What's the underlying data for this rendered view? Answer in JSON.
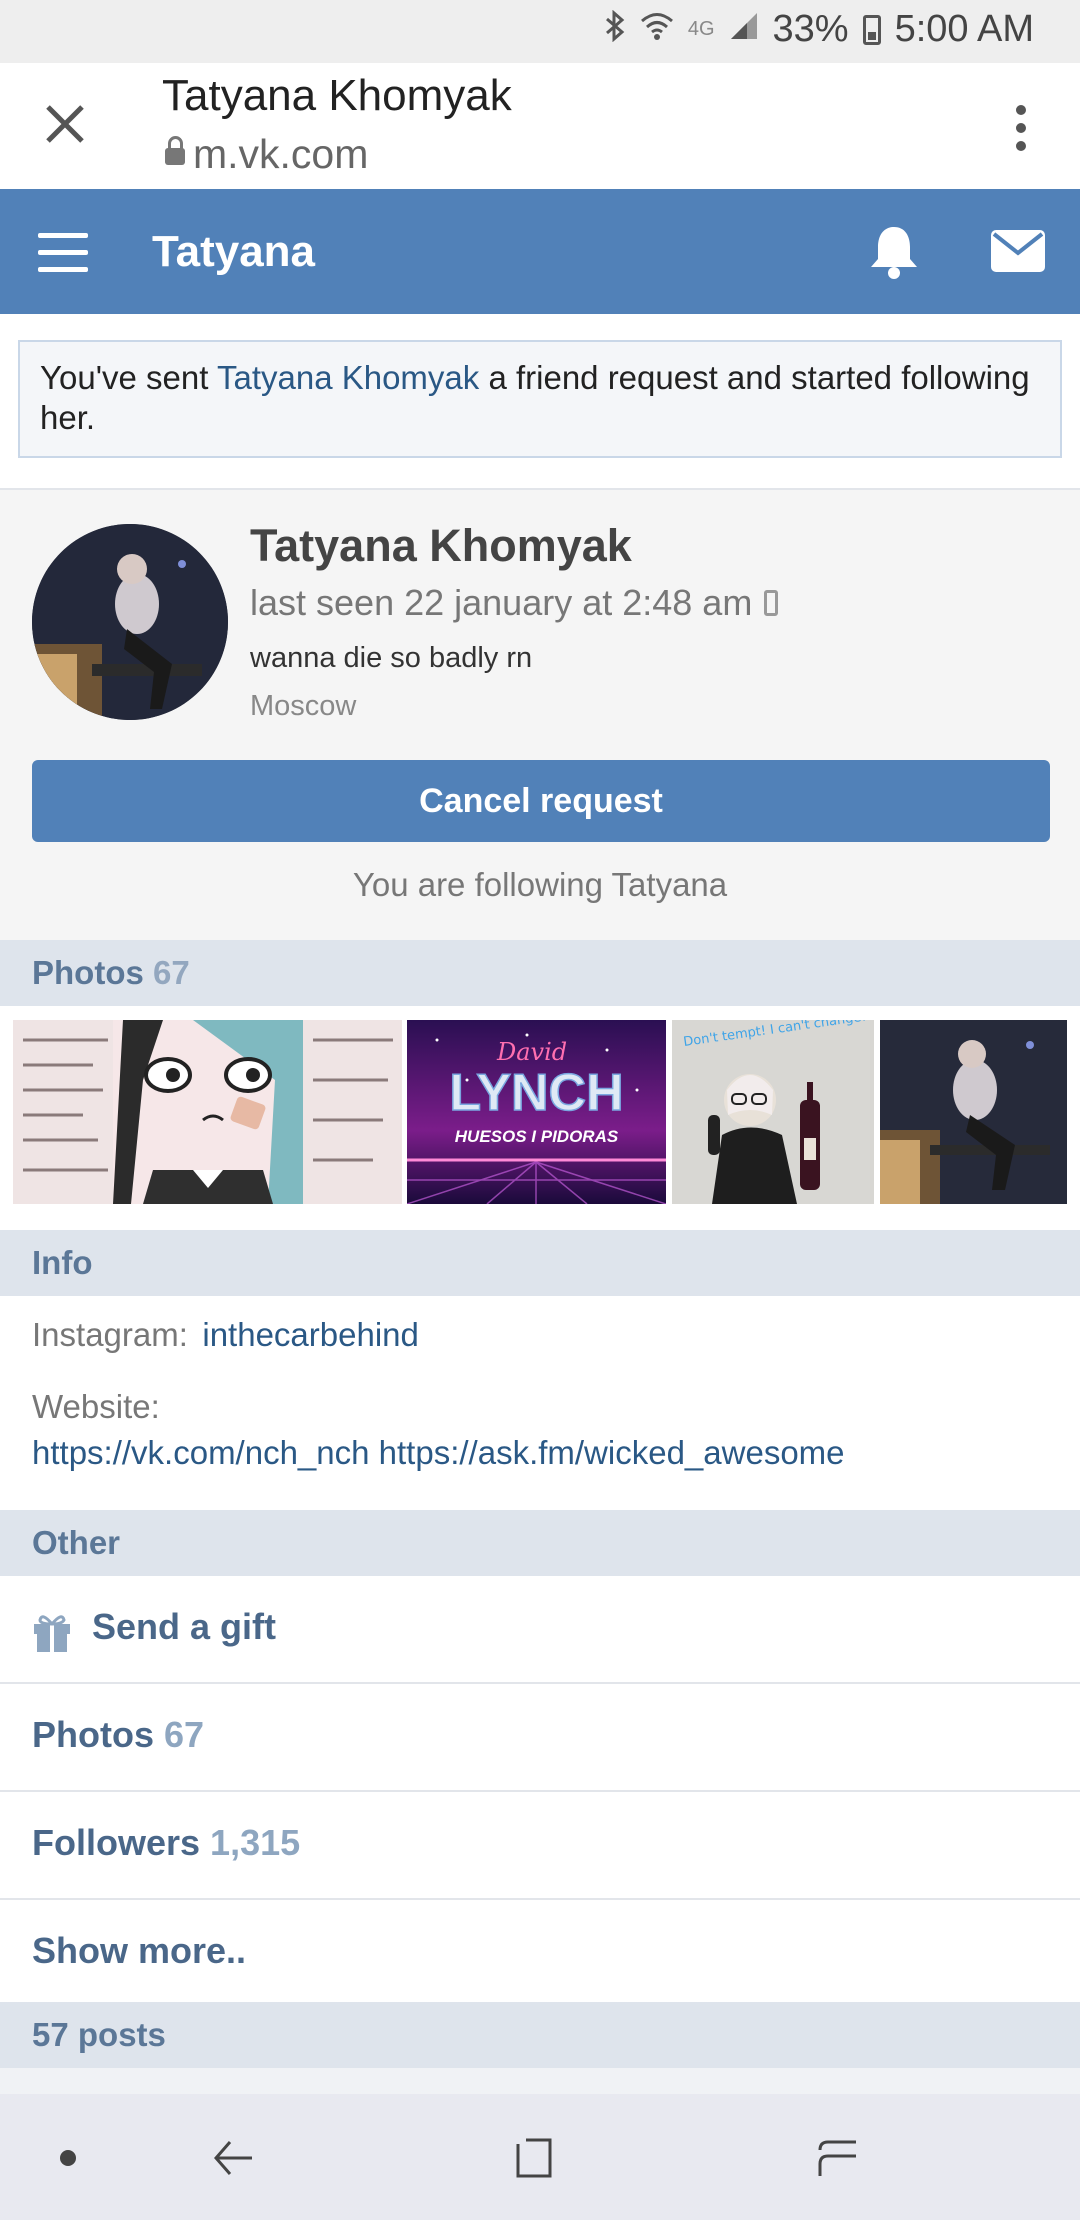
{
  "status_bar": {
    "signal_label": "4G",
    "battery": "33%",
    "time": "5:00 AM"
  },
  "browser": {
    "page_title": "Tatyana Khomyak",
    "url": "m.vk.com"
  },
  "header": {
    "title": "Tatyana"
  },
  "notice": {
    "prefix": "You've sent ",
    "name_link": "Tatyana Khomyak",
    "suffix": " a friend request and started following her."
  },
  "profile": {
    "name": "Tatyana Khomyak",
    "last_seen": "last seen 22 january at 2:48 am",
    "status": "wanna die so badly rn",
    "city": "Moscow",
    "cancel_button": "Cancel request",
    "following_text": "You are following Tatyana"
  },
  "photos_section": {
    "label": "Photos",
    "count": "67",
    "thumb_texts": {
      "lynch_script": "David",
      "lynch_title": "LYNCH",
      "lynch_subtitle": "HUESOS I PIDORAS",
      "neon_text": "Don't tempt! I can't change!"
    }
  },
  "info_section": {
    "label": "Info",
    "instagram_label": "Instagram:",
    "instagram_value": "inthecarbehind",
    "website_label": "Website:",
    "website_value": "https://vk.com/nch_nch https://ask.fm/wicked_awesome"
  },
  "other_section": {
    "label": "Other",
    "send_gift": "Send a gift",
    "photos_label": "Photos",
    "photos_count": "67",
    "followers_label": "Followers",
    "followers_count": "1,315",
    "show_more": "Show more.."
  },
  "posts_section": {
    "label": "57 posts"
  },
  "colors": {
    "vk_blue": "#5181b8",
    "link": "#2a5885",
    "section_bg": "#dee4ec"
  }
}
